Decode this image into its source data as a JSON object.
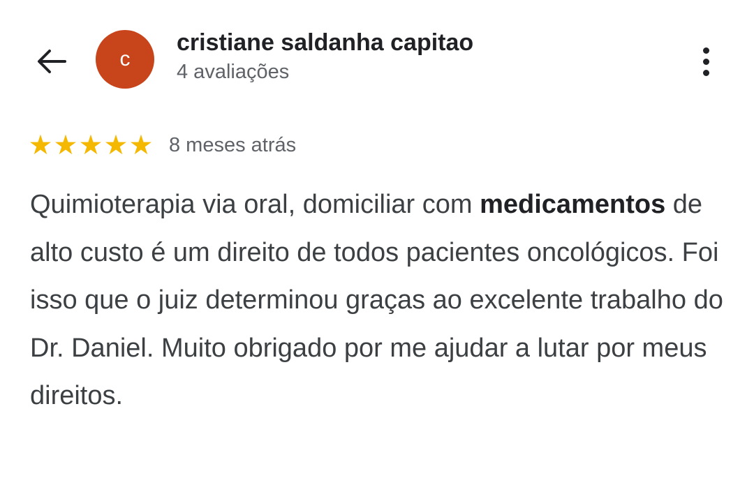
{
  "header": {
    "back_icon": "arrow-left-icon",
    "avatar_letter": "c",
    "avatar_color": "#c8441a",
    "author_name": "cristiane saldanha capitao",
    "review_count": "4 avaliações",
    "more_icon": "more-vertical-icon"
  },
  "rating": {
    "stars": 5,
    "max_stars": 5,
    "star_color": "#f5b800",
    "star_icon": "star-icon",
    "time": "8 meses atrás"
  },
  "review": {
    "text_before": "Quimioterapia via oral, domiciliar com ",
    "highlight": "medicamentos",
    "text_after": " de alto custo é um direito de todos pacientes oncológicos. Foi isso que o juiz determinou graças ao excelente trabalho do Dr. Daniel. Muito obrigado por me ajudar a lutar por meus direitos."
  }
}
